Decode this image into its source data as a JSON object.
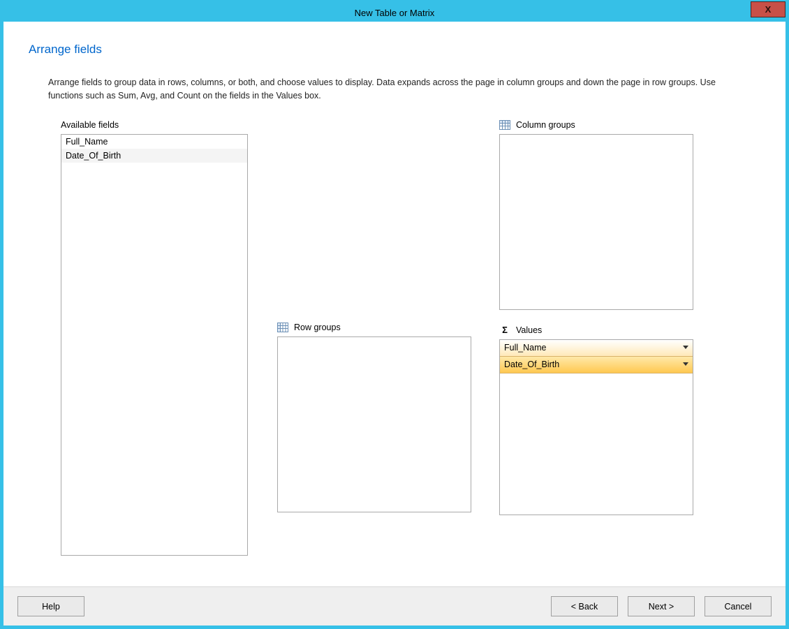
{
  "window": {
    "title": "New Table or Matrix",
    "close_glyph": "X"
  },
  "page": {
    "heading": "Arrange fields",
    "description": "Arrange fields to group data in rows, columns, or both, and choose values to display. Data expands across the page in column groups and down the page in row groups.  Use functions such as Sum, Avg, and Count on the fields in the Values box."
  },
  "labels": {
    "available": "Available fields",
    "column_groups": "Column groups",
    "row_groups": "Row groups",
    "values": "Values"
  },
  "available_fields": [
    "Full_Name",
    "Date_Of_Birth"
  ],
  "column_groups": [],
  "row_groups": [],
  "values": [
    {
      "name": "Full_Name",
      "selected": false
    },
    {
      "name": "Date_Of_Birth",
      "selected": true
    }
  ],
  "buttons": {
    "help": "Help",
    "back": "< Back",
    "next": "Next >",
    "cancel": "Cancel"
  }
}
